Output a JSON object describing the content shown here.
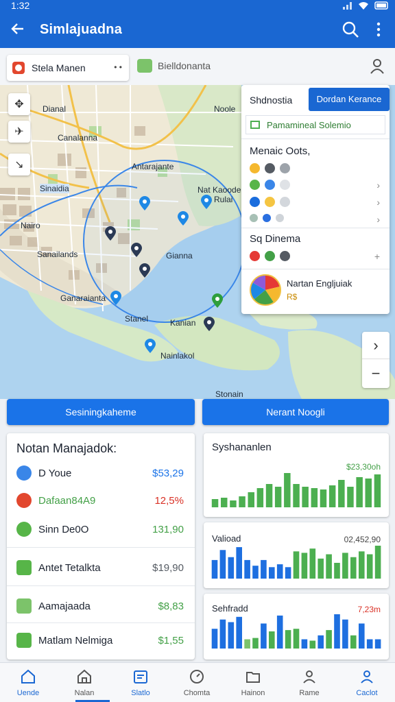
{
  "status": {
    "time": "1:32"
  },
  "appbar": {
    "title": "Simlajuadna"
  },
  "search": {
    "chip1": "Stela Manen",
    "chip2": "Bielldonanta"
  },
  "map": {
    "labels": [
      "Dianal",
      "Noole",
      "Canalanna",
      "Antarajante",
      "Sinaidia",
      "Nat Kaoode",
      "Rulai",
      "Nairo",
      "Sanailands",
      "Gianna",
      "Ganaraianta",
      "Stanel",
      "Kanian",
      "Nainlakol",
      "Stonain"
    ],
    "controls": [
      "compass-icon",
      "navigate-icon",
      "expand-icon"
    ]
  },
  "panel": {
    "title": "Shdnostia",
    "button": "Dordan Kerance",
    "row2": "Pamamineal Solemio",
    "section1": "Menaic Oots,",
    "section2": "Sq Dinema",
    "pie_name": "Nartan Engljuiak",
    "pie_value": "R$",
    "dotrows": [
      [
        "#f5b82e",
        "#555b63",
        "#9da3aa"
      ],
      [
        "#57b548",
        "#3a86e8",
        "#dfe2e6"
      ],
      [
        "#1a6ddd",
        "#f5c542",
        "#d3d7dc"
      ],
      [
        "#a7c0b5",
        "#2a6fe0",
        "#cfd4d9"
      ],
      [
        "#e53935",
        "#43a047",
        "#555b63"
      ]
    ]
  },
  "actions": {
    "left": "Sesiningkaheme",
    "right": "Nerant Noogli"
  },
  "list": {
    "title": "Notan Manajadok:",
    "items": [
      {
        "name": "D Youe",
        "value": "$53,29",
        "icon": "#3a86e8",
        "valcolor": "#1a73e8",
        "namecolor": "#1c2330"
      },
      {
        "name": "Dafaan84A9",
        "value": "12,5%",
        "icon": "#e2472e",
        "valcolor": "#d93025",
        "namecolor": "#43a047"
      },
      {
        "name": "Sinn De0O",
        "value": "131,90",
        "icon": "#57b548",
        "valcolor": "#43a047",
        "namecolor": "#1c2330"
      },
      {
        "name": "Antet Tetalkta",
        "value": "$19,90",
        "icon": "#57b548",
        "valcolor": "#555b63",
        "namecolor": "#1c2330"
      },
      {
        "name": "Aamajaada",
        "value": "$8,83",
        "icon": "#7cc36a",
        "valcolor": "#43a047",
        "namecolor": "#1c2330"
      },
      {
        "name": "Matlam Nelmiga",
        "value": "$1,55",
        "icon": "#57b548",
        "valcolor": "#43a047",
        "namecolor": "#1c2330"
      }
    ]
  },
  "charts": [
    {
      "title": "Syshananlen",
      "value": "$23,30oh",
      "valcolor": "#43a047",
      "bars": [
        12,
        14,
        10,
        16,
        22,
        28,
        34,
        30,
        50,
        34,
        30,
        28,
        26,
        32,
        40,
        30,
        44,
        42,
        48
      ],
      "colors": [
        "#4caf50"
      ]
    },
    {
      "title": "Valioad",
      "value": "02,452,90",
      "valcolor": "#444",
      "bars": [
        26,
        40,
        30,
        44,
        26,
        18,
        26,
        16,
        20,
        16,
        38,
        36,
        42,
        28,
        34,
        22,
        36,
        30,
        38,
        34,
        46
      ],
      "colors": [
        "#1e6fe0",
        "#1e6fe0",
        "#1e6fe0",
        "#1e6fe0",
        "#1e6fe0",
        "#1e6fe0",
        "#1e6fe0",
        "#1e6fe0",
        "#1e6fe0",
        "#1e6fe0",
        "#4caf50",
        "#4caf50",
        "#4caf50",
        "#4caf50",
        "#4caf50",
        "#4caf50",
        "#4caf50",
        "#4caf50",
        "#4caf50",
        "#4caf50",
        "#4caf50"
      ]
    },
    {
      "title": "Sehfradd",
      "value": "7,23m",
      "valcolor": "#d93025",
      "bars": [
        30,
        44,
        40,
        48,
        14,
        16,
        38,
        26,
        50,
        28,
        30,
        14,
        12,
        20,
        28,
        52,
        44,
        20,
        38,
        14,
        14
      ],
      "colors": [
        "#1e6fe0",
        "#1e6fe0",
        "#1e6fe0",
        "#1e6fe0",
        "#7cc36a",
        "#4caf50",
        "#1e6fe0",
        "#4caf50",
        "#1e6fe0",
        "#4caf50",
        "#4caf50",
        "#1e6fe0",
        "#4caf50",
        "#1e6fe0",
        "#4caf50",
        "#1e6fe0",
        "#1e6fe0",
        "#4caf50",
        "#1e6fe0",
        "#1e6fe0",
        "#1e6fe0"
      ]
    }
  ],
  "nav": [
    {
      "label": "Uende",
      "icon": "home-icon",
      "active": true
    },
    {
      "label": "Nalan",
      "icon": "house-icon",
      "active": false
    },
    {
      "label": "Slatlo",
      "icon": "calendar-icon",
      "active": true
    },
    {
      "label": "Chomta",
      "icon": "gauge-icon",
      "active": false
    },
    {
      "label": "Hainon",
      "icon": "folder-icon",
      "active": false
    },
    {
      "label": "Rame",
      "icon": "person-icon",
      "active": false
    },
    {
      "label": "Caclot",
      "icon": "profile-icon",
      "active": true
    }
  ]
}
